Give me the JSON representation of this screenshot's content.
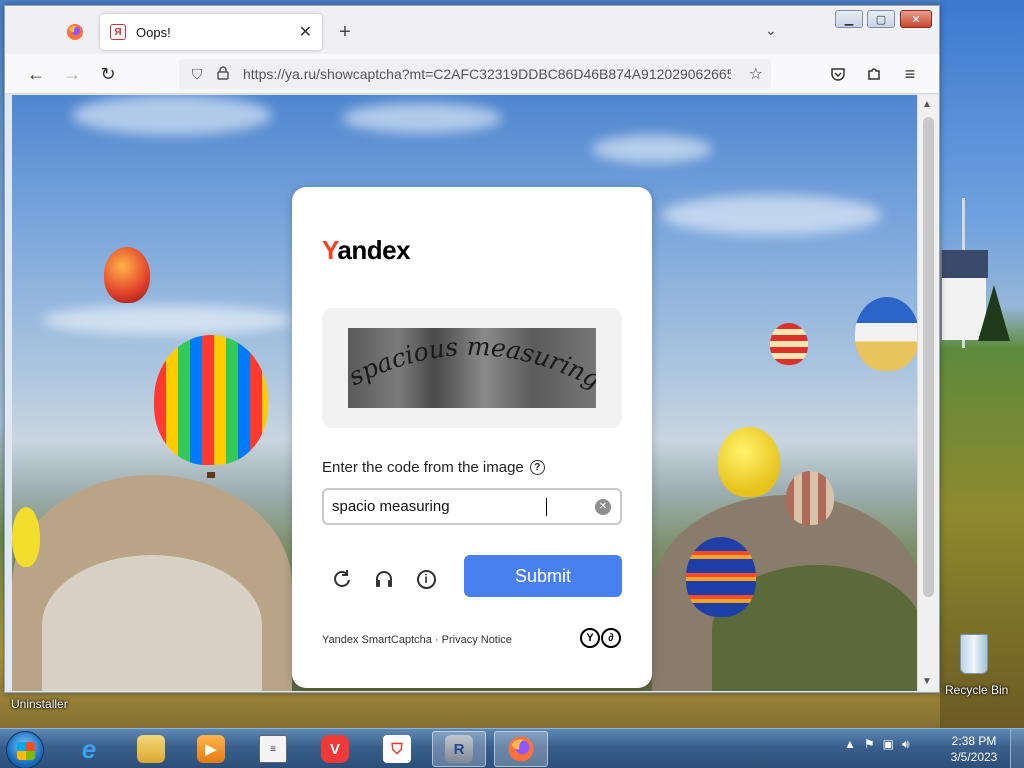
{
  "browser": {
    "tabs": [
      {
        "title": "Oops!",
        "favicon": "Я"
      }
    ],
    "new_tab_icon": "+",
    "url": "https://ya.ru/showcaptcha?mt=C2AFC32319DDBC86D46B874A912029062665",
    "nav_icons": [
      "back-arrow-icon",
      "forward-arrow-icon",
      "reload-icon"
    ]
  },
  "captcha": {
    "logo_first": "Y",
    "logo_rest": "andex",
    "image_text": "spacious measuring",
    "prompt": "Enter the code from the image",
    "help_icon": "?",
    "input_value": "spacio measuring",
    "submit_label": "Submit",
    "footer_text": "Yandex SmartCaptcha · Privacy Notice",
    "footer_logo": [
      "Y",
      "∂"
    ]
  },
  "desktop": {
    "uninstaller_label": "Uninstaller",
    "recycle_label": "Recycle Bin"
  },
  "taskbar": {
    "time": "2:38 PM",
    "date": "3/5/2023"
  },
  "colors": {
    "accent": "#4a7ff0",
    "yandex_red": "#fc3f1d"
  }
}
